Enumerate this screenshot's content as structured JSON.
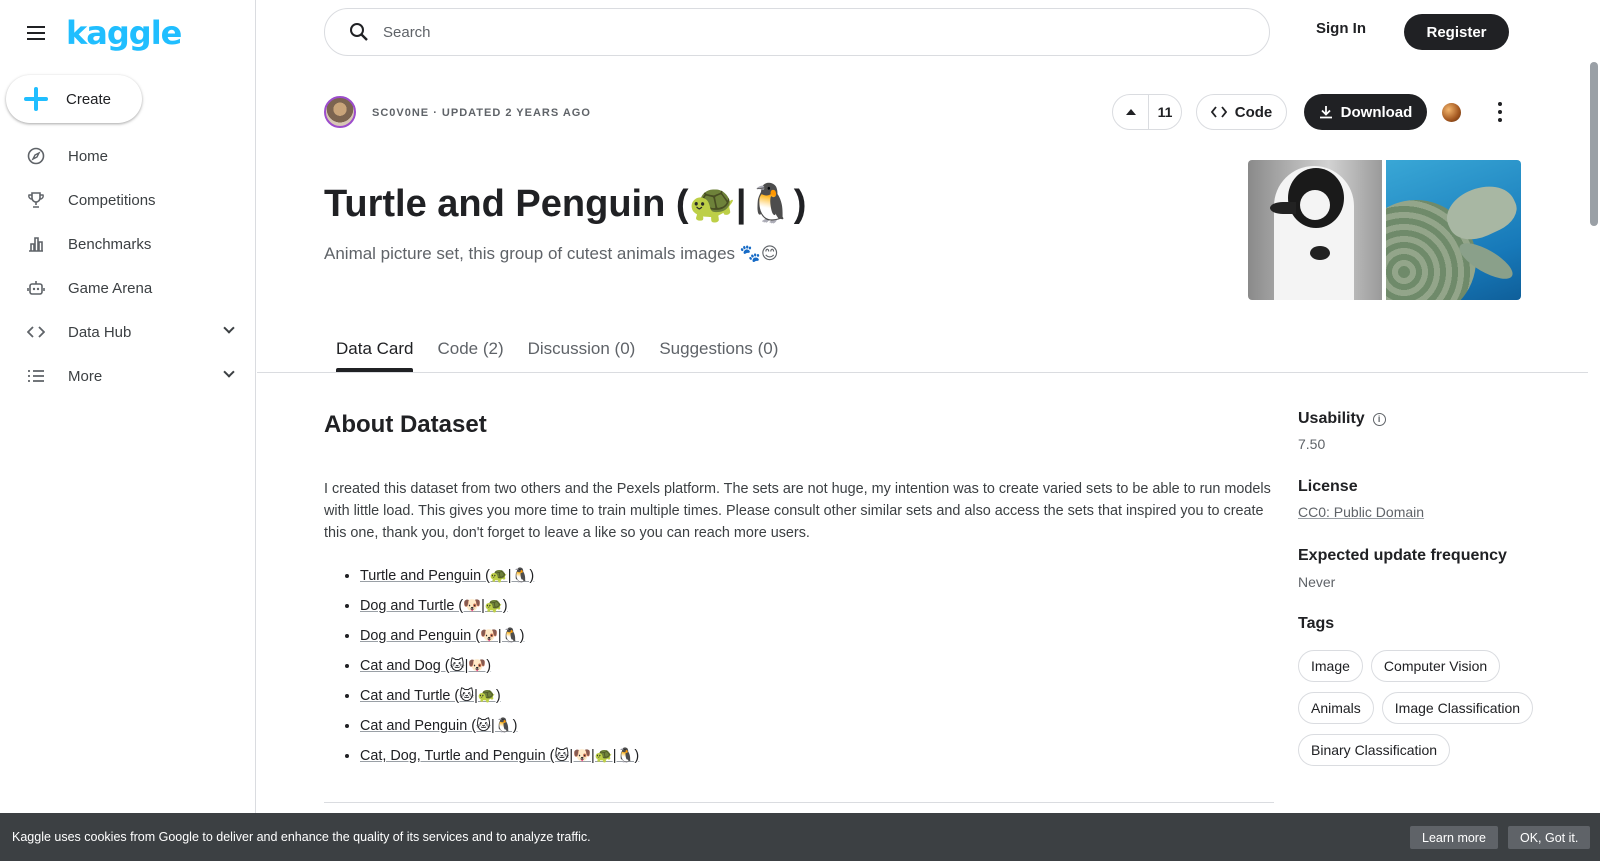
{
  "sidebar": {
    "logo": "kaggle",
    "create_label": "Create",
    "items": [
      {
        "label": "Home",
        "icon": "compass-icon"
      },
      {
        "label": "Competitions",
        "icon": "trophy-icon"
      },
      {
        "label": "Benchmarks",
        "icon": "bar-chart-icon"
      },
      {
        "label": "Game Arena",
        "icon": "robot-icon"
      },
      {
        "label": "Data Hub",
        "icon": "code-brackets-icon"
      },
      {
        "label": "More",
        "icon": "list-icon"
      }
    ]
  },
  "topbar": {
    "search_placeholder": "Search",
    "signin_label": "Sign In",
    "register_label": "Register"
  },
  "dataset": {
    "meta": "SC0V0NE · UPDATED 2 YEARS AGO",
    "vote_count": "11",
    "code_label": "Code",
    "download_label": "Download",
    "title": "Turtle and Penguin (🐢|🐧)",
    "subtitle": "Animal picture set, this group of cutest animals images 🐾😊"
  },
  "tabs": [
    "Data Card",
    "Code (2)",
    "Discussion (0)",
    "Suggestions (0)"
  ],
  "about": {
    "heading": "About Dataset",
    "paragraph": "I created this dataset from two others and the Pexels platform. The sets are not huge, my intention was to create varied sets to be able to run models with little load. This gives you more time to train multiple times. Please consult other similar sets and also access the sets that inspired you to create this one, thank you, don't forget to leave a like so you can reach more users.",
    "links": [
      "Turtle and Penguin (🐢|🐧)",
      "Dog and Turtle (🐶|🐢)",
      "Dog and Penguin (🐶|🐧)",
      "Cat and Dog (🐱|🐶)",
      "Cat and Turtle (🐱|🐢)",
      "Cat and Penguin (🐱|🐧)",
      "Cat, Dog, Turtle and Penguin (🐱|🐶|🐢|🐧)"
    ]
  },
  "side": {
    "usability_label": "Usability",
    "usability_value": "7.50",
    "license_label": "License",
    "license_value": "CC0: Public Domain",
    "frequency_label": "Expected update frequency",
    "frequency_value": "Never",
    "tags_label": "Tags",
    "tags": [
      "Image",
      "Computer Vision",
      "Animals",
      "Image Classification",
      "Binary Classification"
    ]
  },
  "cookie": {
    "text": "Kaggle uses cookies from Google to deliver and enhance the quality of its services and to analyze traffic.",
    "learn_more": "Learn more",
    "ok": "OK, Got it."
  },
  "colors": {
    "brand": "#20beff",
    "dark": "#202124",
    "cookie_bg": "#3c4043"
  }
}
